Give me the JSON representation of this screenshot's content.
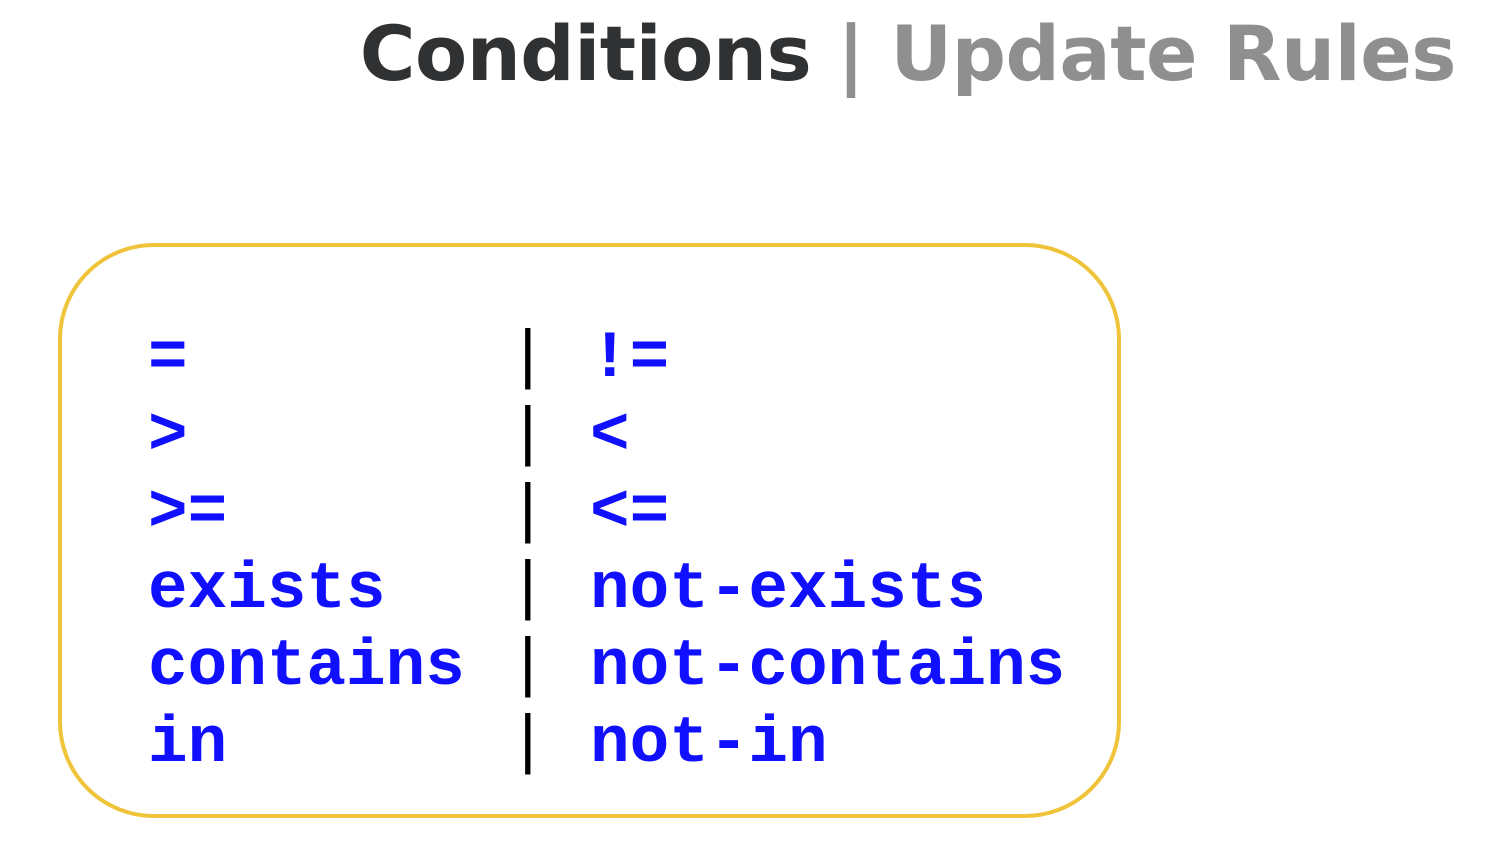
{
  "title": {
    "primary": "Conditions",
    "separator": "|",
    "secondary": "Update Rules"
  },
  "colors": {
    "title_primary": "#2f3133",
    "title_secondary": "#8f8f8f",
    "operator_text": "#1010ff",
    "panel_border": "#f0c43a"
  },
  "operators": [
    {
      "left": "=",
      "separator": "|",
      "right": "!="
    },
    {
      "left": ">",
      "separator": "|",
      "right": "<"
    },
    {
      "left": ">=",
      "separator": "|",
      "right": "<="
    },
    {
      "left": "exists",
      "separator": "|",
      "right": "not-exists"
    },
    {
      "left": "contains",
      "separator": "|",
      "right": "not-contains"
    },
    {
      "left": "in",
      "separator": "|",
      "right": "not-in"
    }
  ]
}
